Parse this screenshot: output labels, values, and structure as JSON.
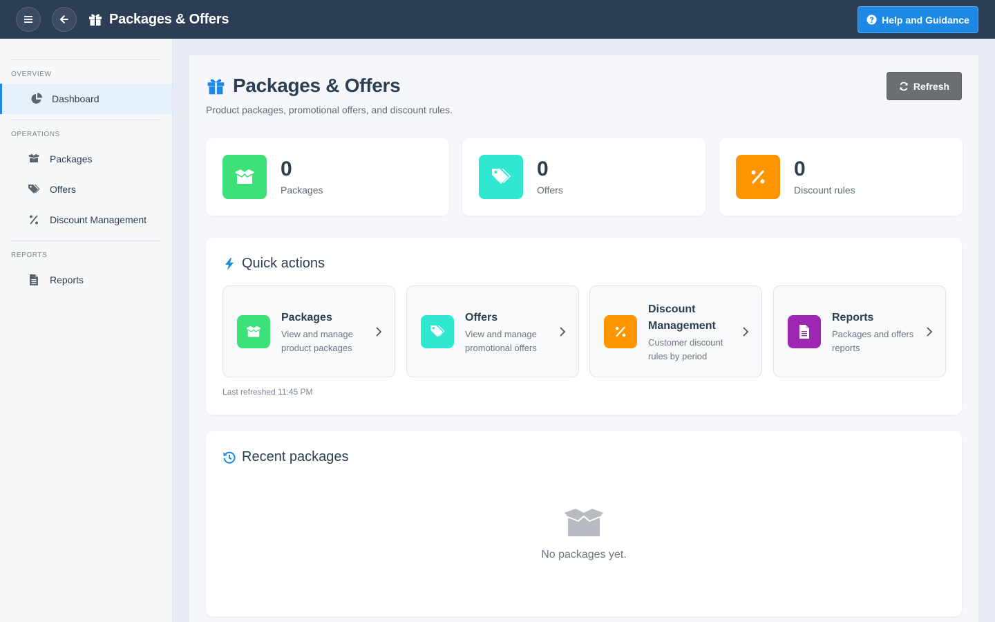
{
  "topbar": {
    "title": "Packages & Offers",
    "help_label": "Help and Guidance",
    "bg_color": "#2c3e56",
    "help_color": "#1e88e5"
  },
  "sidebar": {
    "sections": [
      {
        "label": "OVERVIEW",
        "items": [
          {
            "label": "Dashboard",
            "icon": "pie-chart-icon",
            "active": true
          }
        ]
      },
      {
        "label": "OPERATIONS",
        "items": [
          {
            "label": "Packages",
            "icon": "box-icon"
          },
          {
            "label": "Offers",
            "icon": "tags-icon"
          },
          {
            "label": "Discount Management",
            "icon": "percent-icon"
          }
        ]
      },
      {
        "label": "REPORTS",
        "items": [
          {
            "label": "Reports",
            "icon": "file-icon"
          }
        ]
      }
    ]
  },
  "page": {
    "title": "Packages & Offers",
    "subtitle": "Product packages, promotional offers, and discount rules.",
    "refresh_label": "Refresh"
  },
  "stats": [
    {
      "value": "0",
      "label": "Packages",
      "icon": "box-open-icon",
      "color": "#3ee07a"
    },
    {
      "value": "0",
      "label": "Offers",
      "icon": "tags-icon",
      "color": "#2ee8d2"
    },
    {
      "value": "0",
      "label": "Discount rules",
      "icon": "percent-icon",
      "color": "#ff9500"
    }
  ],
  "quick_actions": {
    "title": "Quick actions",
    "items": [
      {
        "title": "Packages",
        "desc": "View and manage product packages",
        "icon": "box-open-icon",
        "color": "#3ee07a"
      },
      {
        "title": "Offers",
        "desc": "View and manage promotional offers",
        "icon": "tags-icon",
        "color": "#2ee8d2"
      },
      {
        "title": "Discount Management",
        "desc": "Customer discount rules by period",
        "icon": "percent-icon",
        "color": "#ff9500"
      },
      {
        "title": "Reports",
        "desc": "Packages and offers reports",
        "icon": "file-icon",
        "color": "#9c27b0"
      }
    ],
    "last_refreshed": "Last refreshed 11:45 PM"
  },
  "recent_packages": {
    "title": "Recent packages",
    "empty_text": "No packages yet."
  }
}
